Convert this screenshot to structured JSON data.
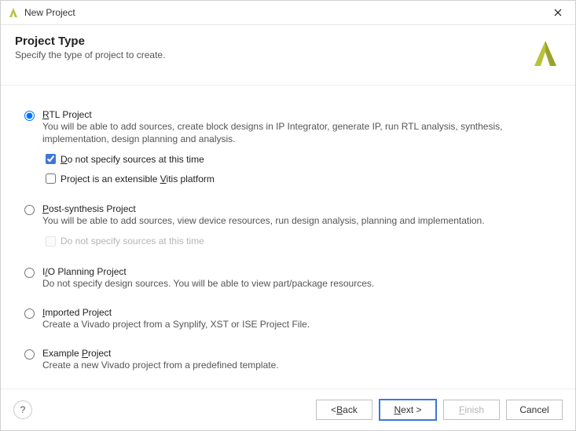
{
  "titlebar": {
    "title": "New Project"
  },
  "header": {
    "title": "Project Type",
    "subtitle": "Specify the type of project to create."
  },
  "options": {
    "rtl": {
      "title_pre": "",
      "title_mn": "R",
      "title_post": "TL Project",
      "desc": "You will be able to add sources, create block designs in IP Integrator, generate IP, run RTL analysis, synthesis, implementation, design planning and analysis.",
      "selected": true,
      "sub_nosources": {
        "pre": "",
        "mn": "D",
        "post": "o not specify sources at this time",
        "checked": true
      },
      "sub_vitis": {
        "pre": "Project is an extensible ",
        "mn": "V",
        "post": "itis platform",
        "checked": false
      }
    },
    "postsynth": {
      "title_pre": "",
      "title_mn": "P",
      "title_post": "ost-synthesis Project",
      "desc": "You will be able to add sources, view device resources, run design analysis, planning and implementation.",
      "selected": false,
      "sub_nosources": {
        "text": "Do not specify sources at this time",
        "disabled": true
      }
    },
    "io": {
      "title_pre": "I",
      "title_mn": "/",
      "title_post": "O Planning Project",
      "desc": "Do not specify design sources. You will be able to view part/package resources.",
      "selected": false
    },
    "imported": {
      "title_pre": "",
      "title_mn": "I",
      "title_post": "mported Project",
      "desc": "Create a Vivado project from a Synplify, XST or ISE Project File.",
      "selected": false
    },
    "example": {
      "title_pre": "Example ",
      "title_mn": "P",
      "title_post": "roject",
      "desc": "Create a new Vivado project from a predefined template.",
      "selected": false
    }
  },
  "footer": {
    "help": "?",
    "back_pre": "< ",
    "back_mn": "B",
    "back_post": "ack",
    "next_pre": "",
    "next_mn": "N",
    "next_post": "ext >",
    "finish_pre": "",
    "finish_mn": "F",
    "finish_post": "inish",
    "cancel": "Cancel"
  }
}
